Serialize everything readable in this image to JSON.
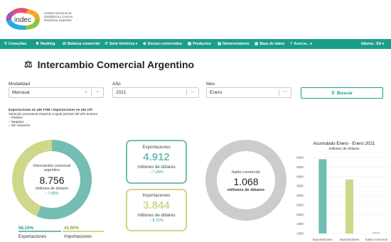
{
  "brand": {
    "logo_text": "indec",
    "org_lines": [
      "Instituto Nacional de",
      "Estadística y Censos",
      "República Argentina"
    ]
  },
  "colors": {
    "teal": "#1a9e8a",
    "export": "#73bdb4",
    "import": "#cfd78a",
    "saldo": "#cccccc",
    "negative": "#d9534f"
  },
  "nav": {
    "items": [
      {
        "icon": "search-icon",
        "label": "Consultas"
      },
      {
        "icon": "trophy-icon",
        "label": "Ranking"
      },
      {
        "icon": "scale-icon",
        "label": "Balanza comercial"
      },
      {
        "icon": "history-icon",
        "label": "Serie histórica ▾"
      },
      {
        "icon": "globe-icon",
        "label": "Socios comerciales"
      },
      {
        "icon": "boxes-icon",
        "label": "Productos"
      },
      {
        "icon": "file-icon",
        "label": "Nomenclatores"
      },
      {
        "icon": "database-icon",
        "label": "Base de datos"
      },
      {
        "icon": "question-icon",
        "label": "Acerca... ▾"
      }
    ],
    "language": "Idioma - ES ▾"
  },
  "page": {
    "title": "Intercambio Comercial Argentino"
  },
  "filters": {
    "modalidad": {
      "label": "Modalidad",
      "value": "Mensual"
    },
    "anio": {
      "label": "Año",
      "value": "2021"
    },
    "mes": {
      "label": "Mes",
      "value": "Enero"
    },
    "search_label": "Buscar"
  },
  "legend": {
    "line1": "Exportaciones en u$s FOB / Importaciones en u$s CIF",
    "line2": "Variación porcentual respecto a igual período del año anterior",
    "positivo": "Positivo",
    "negativo": "Negativo",
    "sin_variacion": "Sin variación"
  },
  "intercambio": {
    "label_line1": "Intercambio comercial",
    "label_line2": "argentino",
    "value": "8.756",
    "unit": "millones de dólares",
    "delta": "7,89%",
    "export_pct": "56,10%",
    "import_pct": "43,90%",
    "export_label": "Exportaciones",
    "import_label": "Importaciones",
    "export_share": 0.561
  },
  "exportaciones": {
    "label": "Exportaciones",
    "value": "4.912",
    "unit": "millones de dólares",
    "delta": "7,26%"
  },
  "importaciones": {
    "label": "Importaciones",
    "value": "3.844",
    "unit": "millones de dólares",
    "delta": "8,71%"
  },
  "saldo": {
    "label": "Saldo comercial:",
    "value": "1.068",
    "unit": "millones de dólares"
  },
  "chart_data": {
    "type": "bar",
    "title": "Acumulado Enero - Enero 2021",
    "subtitle": "millones de dólares",
    "categories": [
      "Exportaciones",
      "Importaciones",
      "Saldo comercial"
    ],
    "values": [
      4912,
      3844,
      1068
    ],
    "ylim": [
      1000,
      5000
    ],
    "yticks": [
      5000,
      4500,
      4000,
      3500,
      3000,
      2500,
      2000,
      1500,
      1000
    ],
    "bar_colors": [
      "#73bdb4",
      "#cfd78a",
      "#cccccc"
    ],
    "grid": true
  }
}
